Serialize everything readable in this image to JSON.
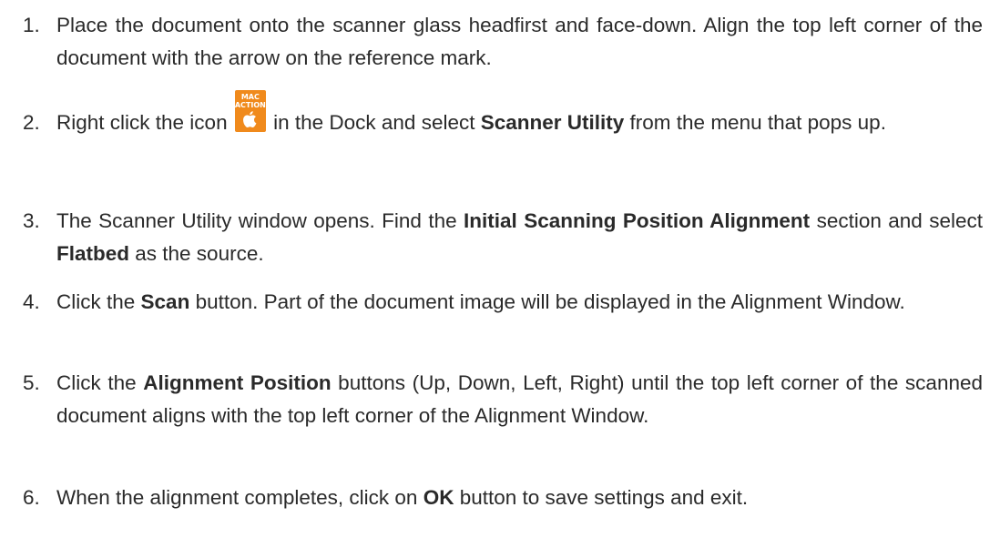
{
  "steps": [
    {
      "num": "1.",
      "parts": [
        {
          "t": "Place the document onto the scanner glass headfirst and face-down. Align the top left corner of the document with the arrow on the reference mark."
        }
      ]
    },
    {
      "num": "2.",
      "parts": [
        {
          "t": "Right click the icon "
        },
        {
          "icon": "mac-action-icon"
        },
        {
          "t": " in the Dock and select "
        },
        {
          "t": "Scanner Utility",
          "b": true
        },
        {
          "t": " from the menu that pops up."
        }
      ]
    },
    {
      "num": "3.",
      "parts": [
        {
          "t": "The Scanner Utility window opens. Find the "
        },
        {
          "t": "Initial Scanning Position Alignment",
          "b": true
        },
        {
          "t": " section and select "
        },
        {
          "t": "Flatbed",
          "b": true
        },
        {
          "t": " as the source."
        }
      ]
    },
    {
      "num": "4.",
      "parts": [
        {
          "t": "Click the "
        },
        {
          "t": "Scan",
          "b": true
        },
        {
          "t": " button. Part of the document image will be displayed in the Alignment Window."
        }
      ]
    },
    {
      "num": "5.",
      "parts": [
        {
          "t": "Click the "
        },
        {
          "t": "Alignment Position",
          "b": true
        },
        {
          "t": " buttons (Up, Down, Left, Right) until the top left corner of the scanned document aligns with the top left corner of the Alignment Window."
        }
      ]
    },
    {
      "num": "6.",
      "parts": [
        {
          "t": "When the alignment completes, click on "
        },
        {
          "t": "OK",
          "b": true
        },
        {
          "t": " button to save settings and exit."
        }
      ]
    }
  ],
  "icon_text": {
    "line1": "MAC",
    "line2": "ACTION"
  },
  "icon_color": "#f08a1c"
}
